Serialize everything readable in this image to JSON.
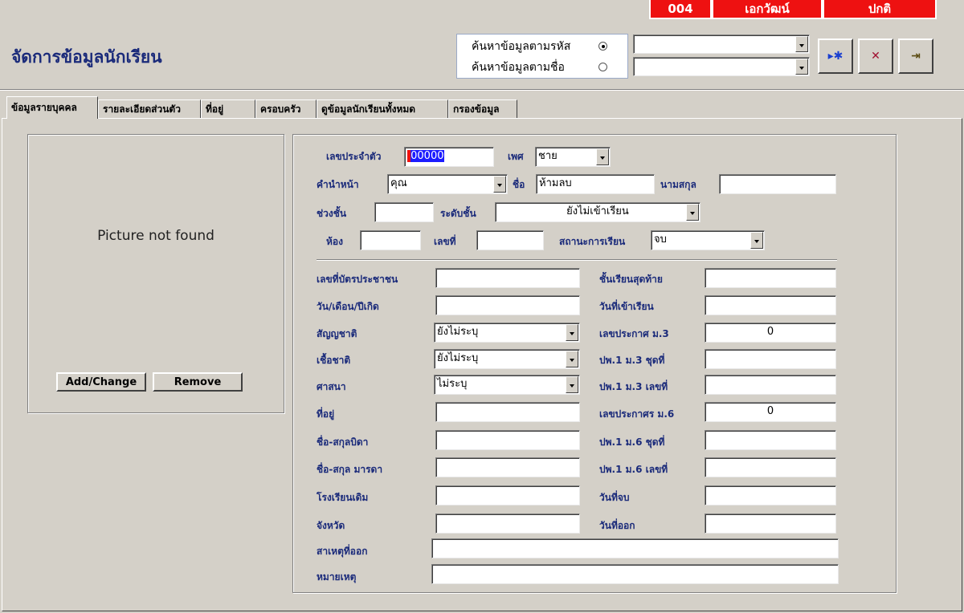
{
  "status": {
    "code": "004",
    "name": "เอกวัฒน์",
    "status": "ปกติ"
  },
  "title": "จัดการข้อมูลนักเรียน",
  "search": {
    "by_code_label": "ค้นหาข้อมูลตามรหัส",
    "by_name_label": "ค้นหาข้อมูลตามชื่อ",
    "by_code_value": "",
    "by_name_value": ""
  },
  "toolbar": {
    "find_glyph": "▸✱",
    "cancel_glyph": "✕",
    "exit_glyph": "⇥"
  },
  "tabs": [
    "ข้อมูลรายบุคคล",
    "รายละเอียดส่วนตัว",
    "ที่อยู่",
    "ครอบครัว",
    "ดูข้อมูลนักเรียนทั้งหมด",
    "กรองข้อมูล"
  ],
  "picture": {
    "placeholder": "Picture not found",
    "add_label": "Add/Change",
    "remove_label": "Remove"
  },
  "form": {
    "student_id_label": "เลขประจำตัว",
    "student_id_value": "00000",
    "gender_label": "เพศ",
    "gender_value": "ชาย",
    "prefix_label": "คำนำหน้า",
    "prefix_value": "คุณ",
    "firstname_label": "ชื่อ",
    "firstname_value": "ห้ามลบ",
    "lastname_label": "นามสกุล",
    "lastname_value": "",
    "grade_range_label": "ช่วงชั้น",
    "grade_range_value": "",
    "grade_level_label": "ระดับชั้น",
    "grade_level_value": "ยังไม่เข้าเรียน",
    "room_label": "ห้อง",
    "room_value": "",
    "number_label": "เลขที่",
    "number_value": "",
    "study_status_label": "สถานะการเรียน",
    "study_status_value": "จบ",
    "id_card_label": "เลขที่บัตรประชาชน",
    "id_card_value": "",
    "birthdate_label": "วัน/เดือน/ปีเกิด",
    "birthdate_value": "",
    "nationality_label": "สัญญชาติ",
    "nationality_value": "ยังไม่ระบุ",
    "race_label": "เชื้อชาติ",
    "race_value": "ยังไม่ระบุ",
    "religion_label": "ศาสนา",
    "religion_value": "ไม่ระบุ",
    "address_label": "ที่อยู่",
    "address_value": "",
    "father_label": "ชื่อ-สกุลบิดา",
    "father_value": "",
    "mother_label": "ชื่อ-สกุล มารดา",
    "mother_value": "",
    "old_school_label": "โรงเรียนเดิม",
    "old_school_value": "",
    "province_label": "จังหวัด",
    "province_value": "",
    "last_grade_label": "ชั้นเรียนสุดท้าย",
    "last_grade_value": "",
    "enroll_date_label": "วันที่เข้าเรียน",
    "enroll_date_value": "",
    "m3_cert_label": "เลขประกาศ ม.3",
    "m3_cert_value": "0",
    "pp1_m3_set_label": "ปพ.1 ม.3 ชุดที่",
    "pp1_m3_set_value": "",
    "pp1_m3_no_label": "ปพ.1 ม.3 เลขที่",
    "pp1_m3_no_value": "",
    "m6_cert_label": "เลขประกาศร ม.6",
    "m6_cert_value": "0",
    "pp1_m6_set_label": "ปพ.1 ม.6 ชุดที่",
    "pp1_m6_set_value": "",
    "pp1_m6_no_label": "ปพ.1 ม.6 เลขที่",
    "pp1_m6_no_value": "",
    "grad_date_label": "วันที่จบ",
    "grad_date_value": "",
    "leave_date_label": "วันที่ออก",
    "leave_date_value": "",
    "leave_reason_label": "สาเหตุที่ออก",
    "leave_reason_value": "",
    "remark_label": "หมายเหตุ",
    "remark_value": ""
  }
}
